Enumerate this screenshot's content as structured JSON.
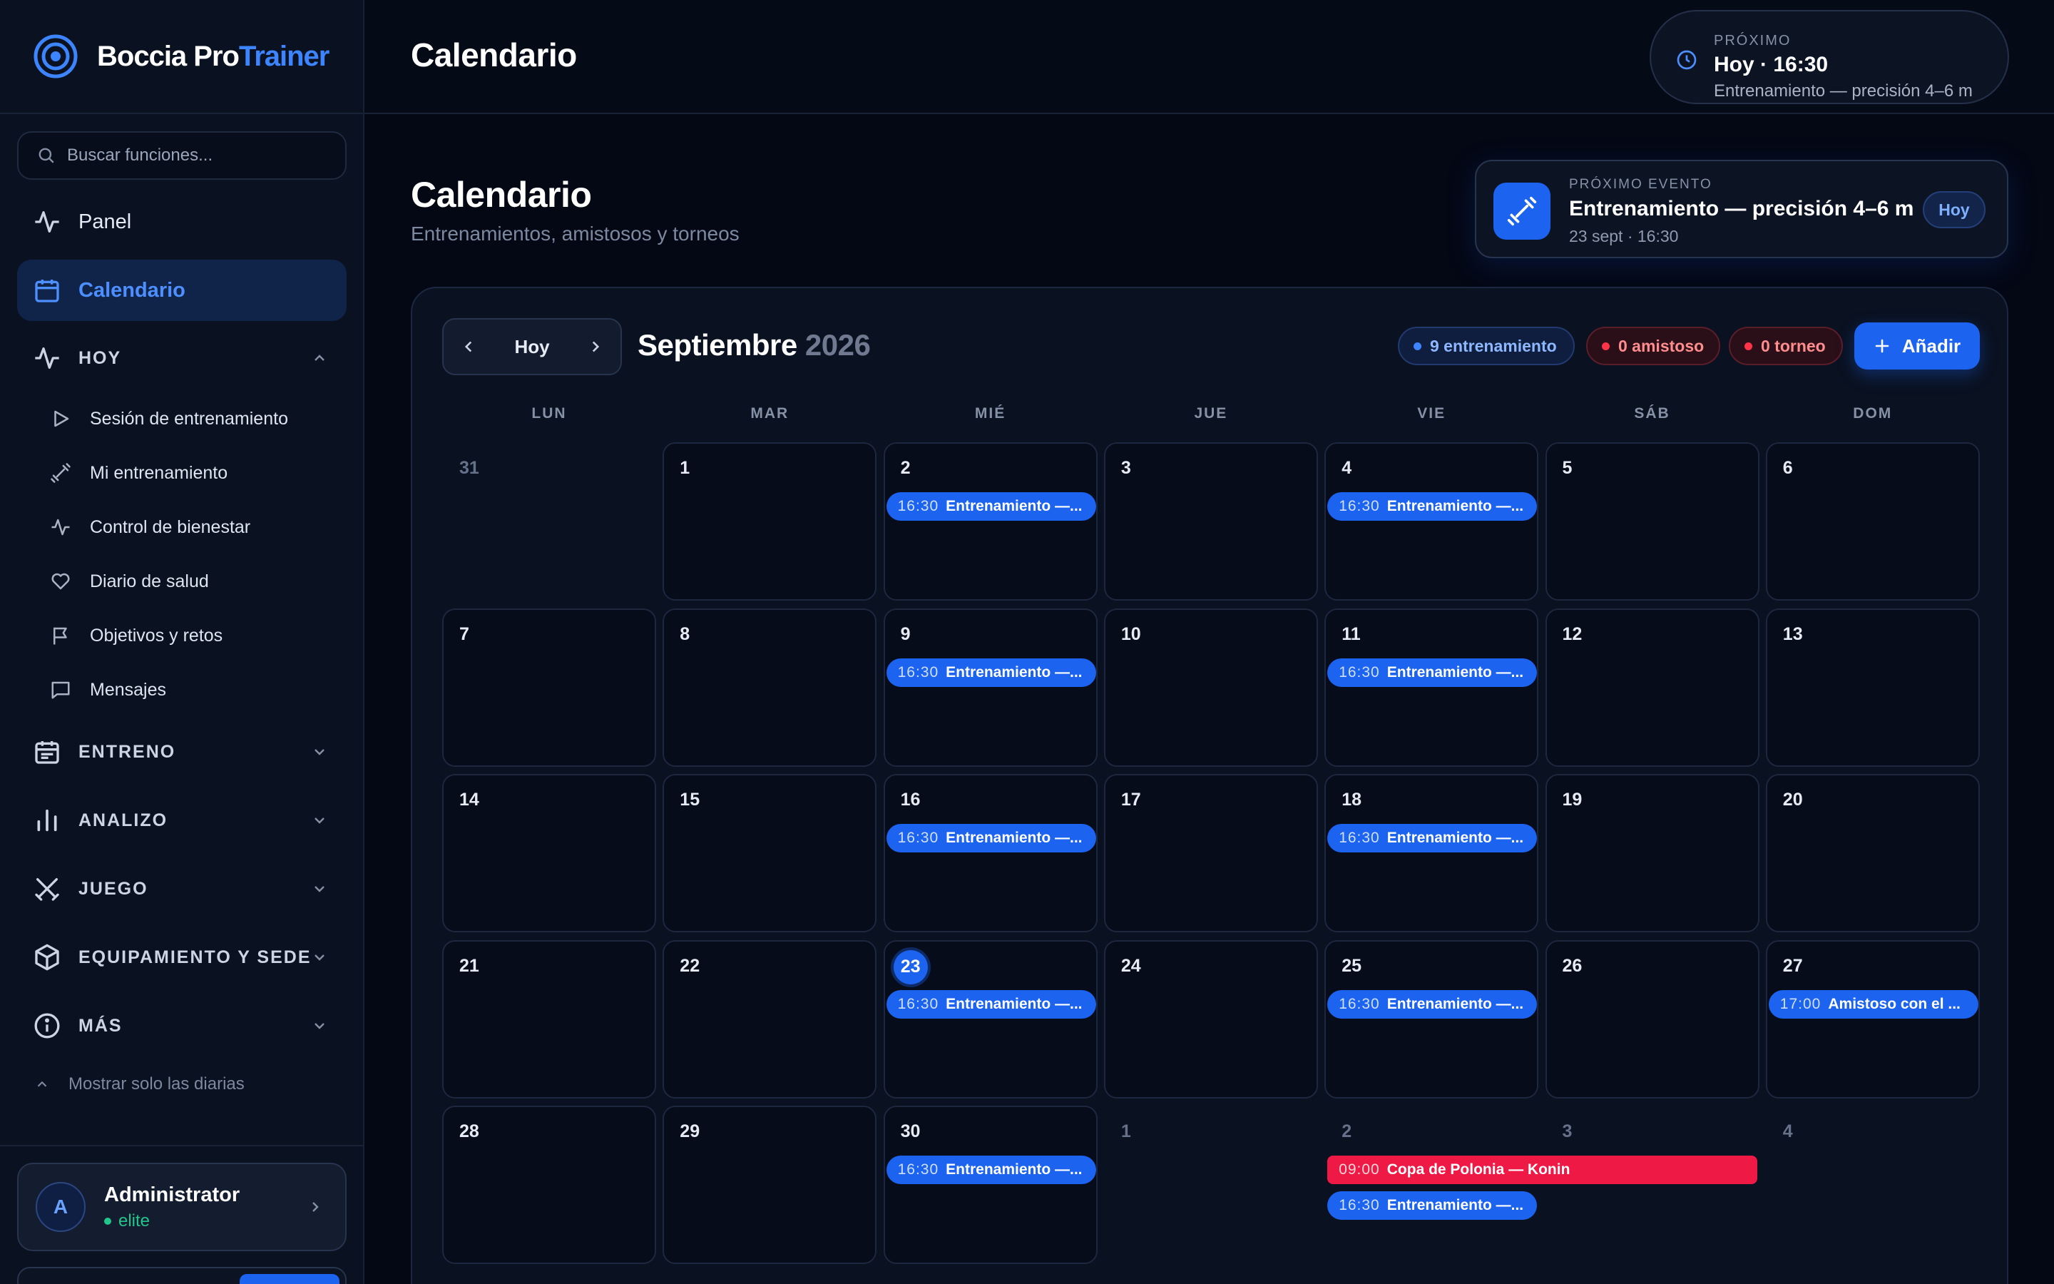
{
  "brand": {
    "name_a": "Boccia Pro",
    "name_b": "Trainer"
  },
  "search": {
    "placeholder": "Buscar funciones..."
  },
  "nav": {
    "panel": "Panel",
    "calendar": "Calendario"
  },
  "sections": {
    "hoy": {
      "label": "HOY",
      "items": [
        "Sesión de entrenamiento",
        "Mi entrenamiento",
        "Control de bienestar",
        "Diario de salud",
        "Objetivos y retos",
        "Mensajes"
      ]
    },
    "entreno": "ENTRENO",
    "analizo": "ANALIZO",
    "juego": "JUEGO",
    "equipamiento": "EQUIPAMIENTO Y SEDE",
    "mas": "MÁS"
  },
  "show_daily": "Mostrar solo las diarias",
  "user": {
    "initial": "A",
    "name": "Administrator",
    "role": "elite"
  },
  "header": {
    "title": "Calendario",
    "next": {
      "label": "PRÓXIMO",
      "time": "Hoy · 16:30",
      "desc": "Entrenamiento — precisión 4–6 m"
    }
  },
  "page": {
    "title": "Calendario",
    "subtitle": "Entrenamientos, amistosos y torneos"
  },
  "next_event": {
    "label": "PRÓXIMO EVENTO",
    "title": "Entrenamiento — precisión 4–6 m",
    "date": "23 sept · 16:30",
    "badge": "Hoy"
  },
  "calendar": {
    "today_label": "Hoy",
    "month": "Septiembre",
    "year": "2026",
    "chips": {
      "training": "9 entrenamiento",
      "friendly": "0 amistoso",
      "tournament": "0 torneo"
    },
    "add_label": "Añadir",
    "weekdays": [
      "LUN",
      "MAR",
      "MIÉ",
      "JUE",
      "VIE",
      "SÁB",
      "DOM"
    ],
    "weeks": [
      [
        {
          "d": "31",
          "out": true,
          "ev": []
        },
        {
          "d": "1",
          "ev": []
        },
        {
          "d": "2",
          "ev": [
            {
              "t": "16:30",
              "l": "Entrenamiento —..."
            }
          ]
        },
        {
          "d": "3",
          "ev": []
        },
        {
          "d": "4",
          "ev": [
            {
              "t": "16:30",
              "l": "Entrenamiento —..."
            }
          ]
        },
        {
          "d": "5",
          "ev": []
        },
        {
          "d": "6",
          "ev": []
        }
      ],
      [
        {
          "d": "7",
          "ev": []
        },
        {
          "d": "8",
          "ev": []
        },
        {
          "d": "9",
          "ev": [
            {
              "t": "16:30",
              "l": "Entrenamiento —..."
            }
          ]
        },
        {
          "d": "10",
          "ev": []
        },
        {
          "d": "11",
          "ev": [
            {
              "t": "16:30",
              "l": "Entrenamiento —..."
            }
          ]
        },
        {
          "d": "12",
          "ev": []
        },
        {
          "d": "13",
          "ev": []
        }
      ],
      [
        {
          "d": "14",
          "ev": []
        },
        {
          "d": "15",
          "ev": []
        },
        {
          "d": "16",
          "ev": [
            {
              "t": "16:30",
              "l": "Entrenamiento —..."
            }
          ]
        },
        {
          "d": "17",
          "ev": []
        },
        {
          "d": "18",
          "ev": [
            {
              "t": "16:30",
              "l": "Entrenamiento —..."
            }
          ]
        },
        {
          "d": "19",
          "ev": []
        },
        {
          "d": "20",
          "ev": []
        }
      ],
      [
        {
          "d": "21",
          "ev": []
        },
        {
          "d": "22",
          "ev": []
        },
        {
          "d": "23",
          "today": true,
          "ev": [
            {
              "t": "16:30",
              "l": "Entrenamiento —..."
            }
          ]
        },
        {
          "d": "24",
          "ev": []
        },
        {
          "d": "25",
          "ev": [
            {
              "t": "16:30",
              "l": "Entrenamiento —..."
            }
          ]
        },
        {
          "d": "26",
          "ev": []
        },
        {
          "d": "27",
          "ev": [
            {
              "t": "17:00",
              "l": "Amistoso con el ..."
            }
          ]
        }
      ],
      [
        {
          "d": "28",
          "ev": []
        },
        {
          "d": "29",
          "ev": []
        },
        {
          "d": "30",
          "ev": [
            {
              "t": "16:30",
              "l": "Entrenamiento —..."
            }
          ]
        },
        {
          "d": "1",
          "out": true,
          "ev": []
        },
        {
          "d": "2",
          "out": true,
          "ev": [
            {
              "t": "09:00",
              "l": "Copa de Polonia — Konin",
              "red": true,
              "span": 2
            },
            {
              "t": "16:30",
              "l": "Entrenamiento —..."
            }
          ]
        },
        {
          "d": "3",
          "out": true,
          "ev": []
        },
        {
          "d": "4",
          "out": true,
          "ev": []
        }
      ]
    ]
  },
  "colors": {
    "accent": "#1c63f0",
    "tournament": "#ee1a45",
    "success": "#22c58a"
  }
}
